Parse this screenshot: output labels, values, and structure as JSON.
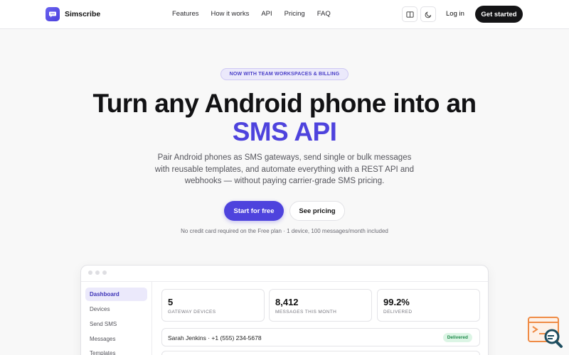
{
  "header": {
    "brand": "Simscribe",
    "nav": [
      "Features",
      "How it works",
      "API",
      "Pricing",
      "FAQ"
    ],
    "login": "Log in",
    "get_started": "Get started",
    "icons": [
      "book-icon",
      "moon-icon"
    ]
  },
  "hero": {
    "badge": "NOW WITH TEAM WORKSPACES & BILLING",
    "title_line1": "Turn any Android phone into an",
    "title_line2": "SMS API",
    "subtitle": "Pair Android phones as SMS gateways, send single or bulk messages with reusable templates, and automate everything with a REST API and webhooks — without paying carrier-grade SMS pricing.",
    "cta_primary": "Start for free",
    "cta_secondary": "See pricing",
    "note": "No credit card required on the Free plan · 1 device, 100 messages/month included"
  },
  "preview": {
    "sidebar": [
      "Dashboard",
      "Devices",
      "Send SMS",
      "Messages",
      "Templates"
    ],
    "active_item": "Dashboard",
    "stats": [
      {
        "value": "5",
        "label": "GATEWAY DEVICES"
      },
      {
        "value": "8,412",
        "label": "MESSAGES THIS MONTH"
      },
      {
        "value": "99.2%",
        "label": "DELIVERED"
      }
    ],
    "message": {
      "text": "Sarah Jenkins · +1 (555) 234-5678",
      "status": "Delivered"
    }
  },
  "colors": {
    "accent": "#4e43dd",
    "dark": "#141416",
    "delivered_bg": "#dcf5e5",
    "delivered_fg": "#1f8a4a"
  }
}
